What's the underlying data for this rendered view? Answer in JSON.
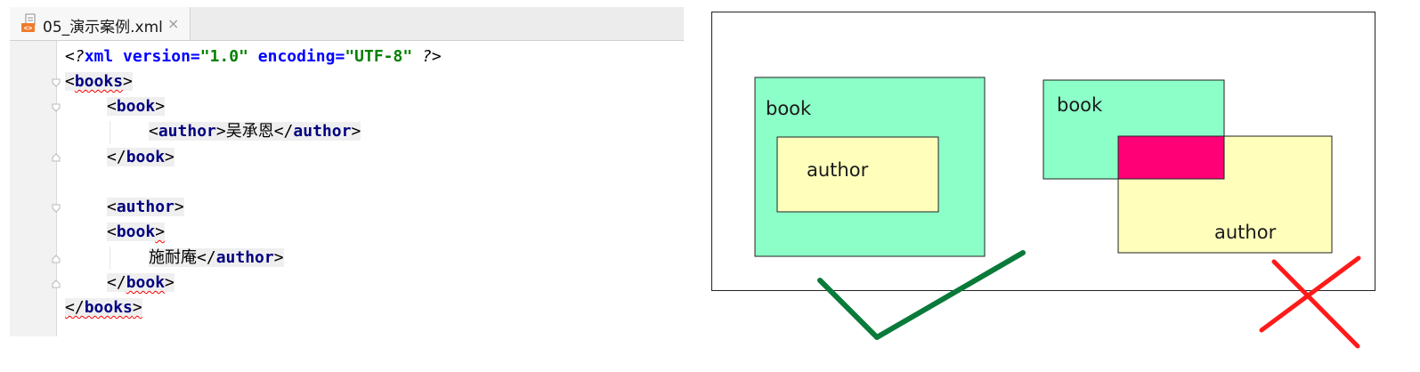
{
  "editor": {
    "tab": {
      "title": "05_演示案例.xml",
      "close": "×"
    },
    "lines": [
      {
        "decl_open": "<",
        "decl_q1": "?",
        "decl_name": "xml",
        "attr1": "version",
        "eq1": "=",
        "val1": "\"1.0\"",
        "attr2": "encoding",
        "eq2": "=",
        "val2": "\"UTF-8\"",
        "decl_close": "?>"
      },
      {
        "open": "<",
        "tag": "books",
        "close": ">"
      },
      {
        "open": "<",
        "tag": "book",
        "close": ">"
      },
      {
        "open": "<",
        "tag": "author",
        "close": ">",
        "text": "吴承恩",
        "end_open": "</",
        "end_tag": "author",
        "end_close": ">"
      },
      {
        "open": "</",
        "tag": "book",
        "close": ">"
      },
      {
        "open": "<",
        "tag": "author",
        "close": ">"
      },
      {
        "open": "<",
        "tag": "book",
        "close": ">"
      },
      {
        "text": "施耐庵",
        "end_open": "</",
        "end_tag": "author",
        "end_close": ">"
      },
      {
        "open": "</",
        "tag": "book",
        "close": ">"
      },
      {
        "open": "</",
        "tag": "books",
        "close": ">"
      }
    ]
  },
  "diagram": {
    "correct": {
      "outer_label": "book",
      "inner_label": "author",
      "mark": "check-mark-icon",
      "mark_color": "#0a7a3a"
    },
    "incorrect": {
      "outer_label": "book",
      "inner_label": "author",
      "mark": "cross-mark-icon",
      "mark_color": "#ff1a1a"
    },
    "colors": {
      "book_fill": "#8cffc8",
      "author_fill": "#ffffbb",
      "overlap_fill": "#ff0077",
      "frame_stroke": "#222222"
    }
  }
}
